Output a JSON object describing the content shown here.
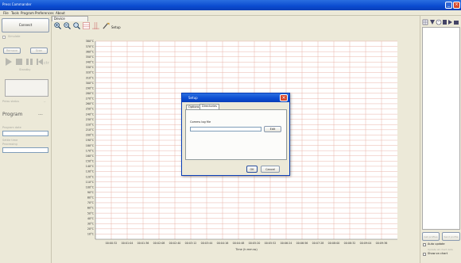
{
  "window": {
    "title": "Press Commander"
  },
  "menu": [
    "File",
    "Tools",
    "Program",
    "Preferences",
    "About"
  ],
  "left": {
    "connect": "Connect",
    "simulate": "Simulate",
    "remove": "Remove",
    "scan": "Scan",
    "standby": "Standby",
    "status": "Press status",
    "program_heading": "Program",
    "program_status": "----",
    "program_label1": "Program date",
    "program_label2": "Settle time",
    "program_label3": "Processing"
  },
  "chart_tab": "Device",
  "setup_label": "Setup",
  "chart_data": {
    "type": "line",
    "xlabel": "Time (h:mm:ss)",
    "x_ticks": [
      "00:00:32",
      "00:01:04",
      "00:01:36",
      "00:02:08",
      "00:02:40",
      "00:03:12",
      "00:03:44",
      "00:04:16",
      "00:04:48",
      "00:05:20",
      "00:05:52",
      "00:06:24",
      "00:06:56",
      "00:07:28",
      "00:08:00",
      "00:08:32",
      "00:09:04",
      "00:09:36"
    ],
    "y_ticks": [
      "10°C",
      "20°C",
      "30°C",
      "40°C",
      "50°C",
      "60°C",
      "70°C",
      "80°C",
      "90°C",
      "100°C",
      "110°C",
      "120°C",
      "130°C",
      "140°C",
      "150°C",
      "160°C",
      "170°C",
      "180°C",
      "190°C",
      "200°C",
      "210°C",
      "220°C",
      "230°C",
      "240°C",
      "250°C",
      "260°C",
      "270°C",
      "280°C",
      "290°C",
      "300°C",
      "310°C",
      "320°C",
      "330°C",
      "340°C",
      "350°C",
      "360°C",
      "370°C",
      "380°C"
    ],
    "ylim": [
      0,
      380
    ],
    "grid": true,
    "series": []
  },
  "right": {
    "btn1": "Get profiles",
    "btn2": "Send profile",
    "auto_update": "Auto update",
    "note": "Update all chart data",
    "show_chart": "Show on chart",
    "colors": {
      "accent": "#0a4bd0",
      "grid": "#e8b4a8"
    }
  },
  "dialog": {
    "title": "Setup",
    "tabs": [
      "Options",
      "Directories"
    ],
    "label": "Comms log file",
    "path_value": "",
    "edit": "Edit",
    "ok": "OK",
    "cancel": "Cancel"
  }
}
